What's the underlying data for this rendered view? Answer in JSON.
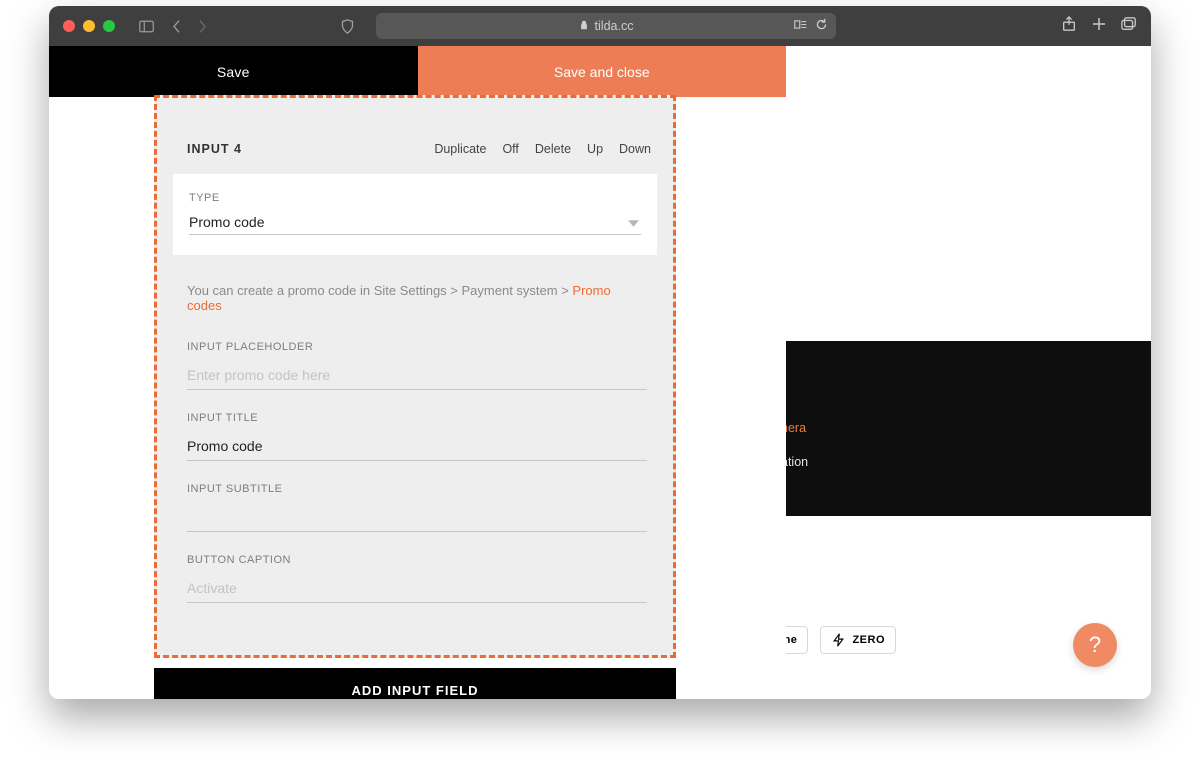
{
  "browser": {
    "domain": "tilda.cc"
  },
  "toolbar": {
    "save_label": "Save",
    "save_close_label": "Save and close"
  },
  "block": {
    "title": "INPUT 4",
    "actions": {
      "duplicate": "Duplicate",
      "off": "Off",
      "delete": "Delete",
      "up": "Up",
      "down": "Down"
    },
    "type_label": "TYPE",
    "type_value": "Promo code",
    "hint_prefix": "You can create a promo code in Site Settings > Payment system > ",
    "hint_link": "Promo codes",
    "fields": {
      "placeholder_label": "INPUT PLACEHOLDER",
      "placeholder_ph": "Enter promo code here",
      "title_label": "INPUT TITLE",
      "title_value": "Promo code",
      "subtitle_label": "INPUT SUBTITLE",
      "subtitle_value": "",
      "button_label": "BUTTON CAPTION",
      "button_ph": "Activate"
    },
    "add_field": "ADD INPUT FIELD"
  },
  "preview": {
    "line1_fragment": "nera",
    "line2_fragment": "ation"
  },
  "block_toolbar": {
    "line": "Line",
    "zero": "ZERO"
  },
  "help": "?"
}
